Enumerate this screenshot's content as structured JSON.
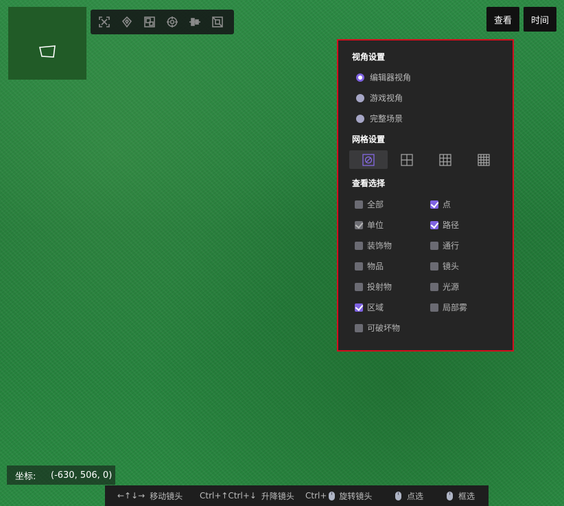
{
  "toolbar": {
    "tools": [
      "fit-icon",
      "rotate-icon",
      "layout-icon",
      "target-icon",
      "align-icon",
      "snap-icon"
    ]
  },
  "top_buttons": {
    "view": "查看",
    "time": "时间"
  },
  "panel": {
    "view_title": "视角设置",
    "view_options": [
      {
        "label": "编辑器视角",
        "selected": true
      },
      {
        "label": "游戏视角",
        "selected": false
      },
      {
        "label": "完整场景",
        "selected": false
      }
    ],
    "grid_title": "网格设置",
    "grid_options": [
      "grid-off-icon",
      "grid-2x2-icon",
      "grid-3x3-icon",
      "grid-4x4-icon"
    ],
    "grid_selected": 0,
    "filter_title": "查看选择",
    "filters_left": [
      {
        "label": "全部",
        "checked": false
      },
      {
        "label": "单位",
        "checked": true,
        "disabled": true
      },
      {
        "label": "装饰物",
        "checked": false
      },
      {
        "label": "物品",
        "checked": false
      },
      {
        "label": "投射物",
        "checked": false
      },
      {
        "label": "区域",
        "checked": true
      },
      {
        "label": "可破坏物",
        "checked": false
      }
    ],
    "filters_right": [
      {
        "label": "点",
        "checked": true
      },
      {
        "label": "路径",
        "checked": true
      },
      {
        "label": "通行",
        "checked": false
      },
      {
        "label": "镜头",
        "checked": false
      },
      {
        "label": "光源",
        "checked": false
      },
      {
        "label": "局部雾",
        "checked": false
      }
    ]
  },
  "coords": {
    "label": "坐标:",
    "value": "(-630, 506, 0)"
  },
  "status": {
    "move_keys": "←↑↓→",
    "move_text": "移动镜头",
    "lift_keys": "Ctrl+↑Ctrl+↓",
    "lift_text": "升降镜头",
    "rotate_keys": "Ctrl+",
    "rotate_text": "旋转镜头",
    "select_text": "点选",
    "box_text": "框选"
  },
  "colors": {
    "accent": "#7f63e3",
    "panel_border": "#d20f1e"
  }
}
